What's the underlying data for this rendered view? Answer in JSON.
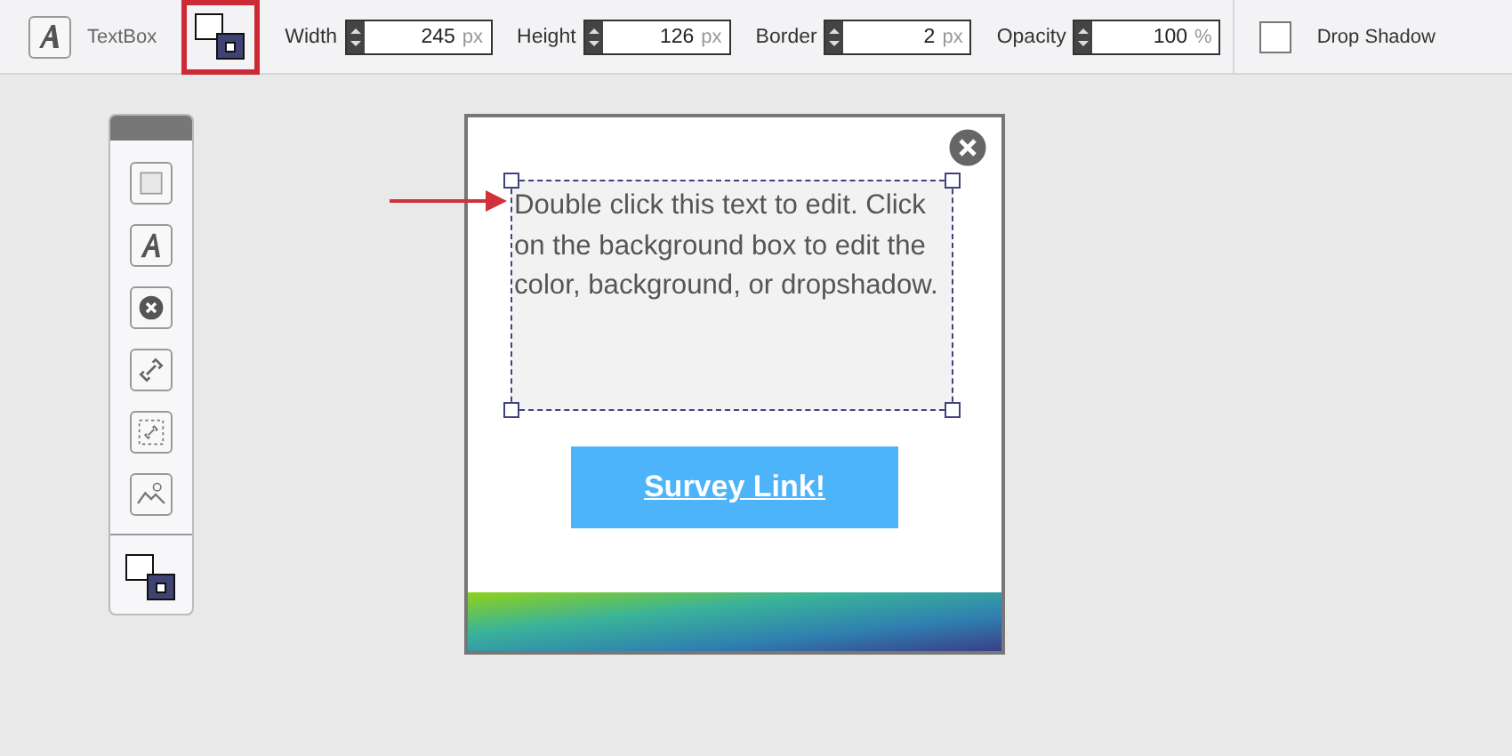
{
  "toolbar": {
    "element_label": "TextBox",
    "style_button": {
      "selected": true
    },
    "fields": [
      {
        "label": "Width",
        "value": "245",
        "unit": "px"
      },
      {
        "label": "Height",
        "value": "126",
        "unit": "px"
      },
      {
        "label": "Border",
        "value": "2",
        "unit": "px"
      },
      {
        "label": "Opacity",
        "value": "100",
        "unit": "%"
      }
    ],
    "drop_shadow": {
      "label": "Drop Shadow",
      "checked": false
    }
  },
  "palette": {
    "tools": [
      {
        "kind": "box"
      },
      {
        "kind": "text"
      },
      {
        "kind": "close"
      },
      {
        "kind": "link"
      },
      {
        "kind": "link-area"
      },
      {
        "kind": "image"
      },
      {
        "kind": "style"
      }
    ]
  },
  "canvas": {
    "text": "Double click this text to edit. Click on the background box to edit the color, background, or dropshadow.",
    "link_button": "Survey Link!"
  }
}
